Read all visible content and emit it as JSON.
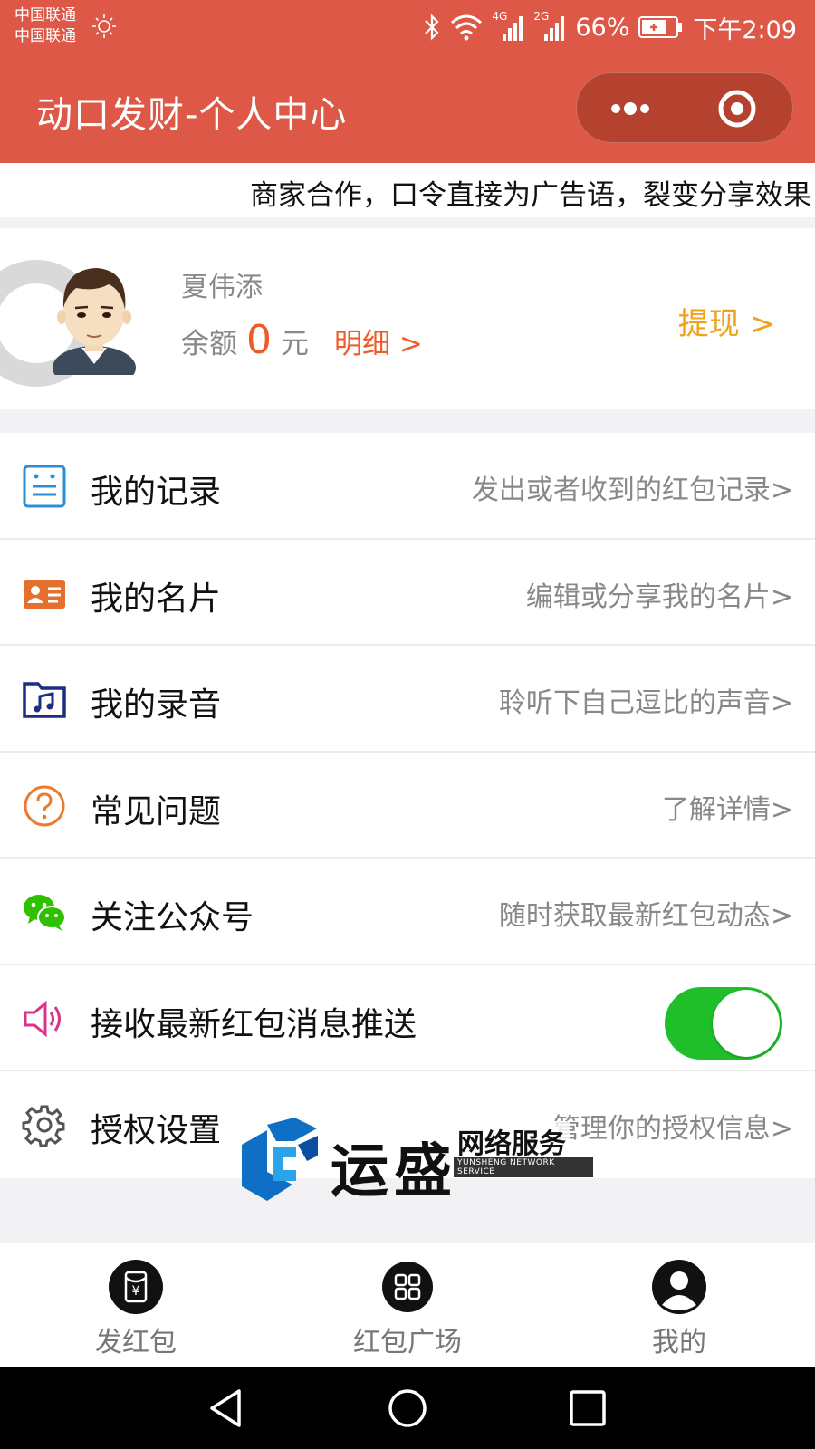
{
  "status_bar": {
    "carrier_1": "中国联通",
    "carrier_2": "中国联通",
    "network_4g": "4G",
    "network_2g": "2G",
    "battery": "66%",
    "time": "下午2:09"
  },
  "nav_bar": {
    "title": "动口发财-个人中心"
  },
  "marquee": {
    "text": "商家合作，口令直接为广告语，裂变分享效果"
  },
  "profile": {
    "name": "夏伟添",
    "balance_label": "余额",
    "balance_value": "0",
    "balance_unit": "元",
    "detail_link": "明细 >",
    "withdraw_link": "提现 >"
  },
  "menu": {
    "items": [
      {
        "label": "我的记录",
        "desc": "发出或者收到的红包记录>",
        "icon": "record-icon"
      },
      {
        "label": "我的名片",
        "desc": "编辑或分享我的名片>",
        "icon": "card-icon"
      },
      {
        "label": "我的录音",
        "desc": "聆听下自己逗比的声音>",
        "icon": "music-folder-icon"
      },
      {
        "label": "常见问题",
        "desc": "了解详情>",
        "icon": "question-icon"
      },
      {
        "label": "关注公众号",
        "desc": "随时获取最新红包动态>",
        "icon": "wechat-icon"
      },
      {
        "label": "接收最新红包消息推送",
        "desc": "",
        "icon": "speaker-icon",
        "toggle_on": true
      },
      {
        "label": "授权设置",
        "desc": "管理你的授权信息>",
        "icon": "gear-icon"
      }
    ]
  },
  "watermark": {
    "title": "运盛",
    "subtitle": "网络服务",
    "english": "YUNSHENG NETWORK SERVICE"
  },
  "tab_bar": {
    "tabs": [
      {
        "label": "发红包",
        "icon": "red-packet-icon"
      },
      {
        "label": "红包广场",
        "icon": "grid-icon"
      },
      {
        "label": "我的",
        "icon": "user-icon"
      }
    ]
  },
  "colors": {
    "brand": "#dd5846",
    "balance": "#f05a28",
    "withdraw": "#f0a21b",
    "toggle_on": "#1fbf2a"
  }
}
